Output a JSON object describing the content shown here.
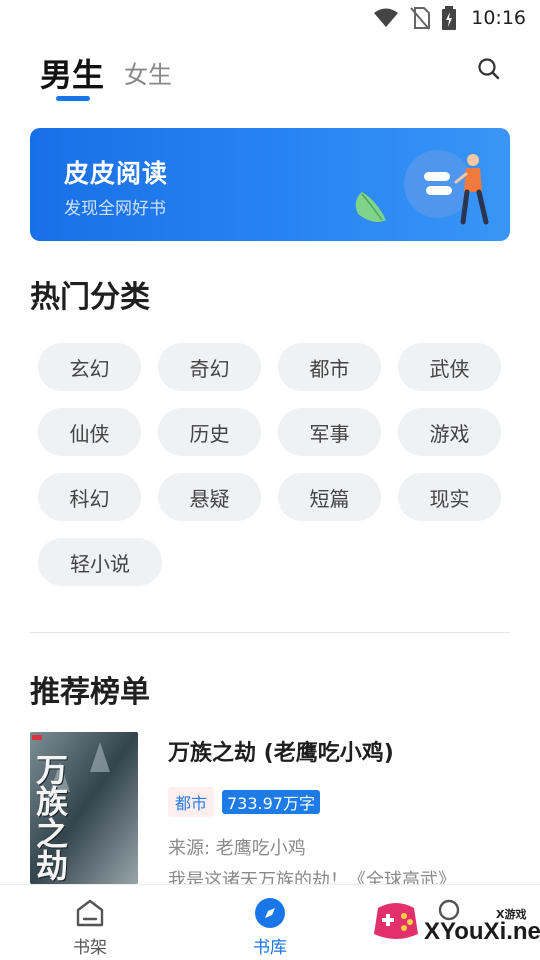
{
  "status_bar": {
    "time": "10:16"
  },
  "header": {
    "tabs": [
      {
        "label": "男生",
        "active": true
      },
      {
        "label": "女生",
        "active": false
      }
    ]
  },
  "banner": {
    "title": "皮皮阅读",
    "subtitle": "发现全网好书"
  },
  "hot_categories": {
    "title": "热门分类",
    "items": [
      "玄幻",
      "奇幻",
      "都市",
      "武侠",
      "仙侠",
      "历史",
      "军事",
      "游戏",
      "科幻",
      "悬疑",
      "短篇",
      "现实",
      "轻小说"
    ]
  },
  "ranking": {
    "title": "推荐榜单",
    "books": [
      {
        "cover_title": "万族之劫",
        "title": "万族之劫 (老鹰吃小鸡)",
        "genre": "都市",
        "words": "733.97万字",
        "source": "来源: 老鹰吃小鸡",
        "description": "我是这诸天万族的劫！《全球高武》"
      }
    ]
  },
  "bottom_nav": [
    {
      "label": "书架",
      "active": false
    },
    {
      "label": "书库",
      "active": true
    }
  ],
  "watermark": {
    "small": "X游戏",
    "text": "XYouXi.net"
  },
  "colors": {
    "accent": "#1976e8",
    "chip_bg": "#f0f1f3",
    "banner_start": "#1a6fe6"
  }
}
